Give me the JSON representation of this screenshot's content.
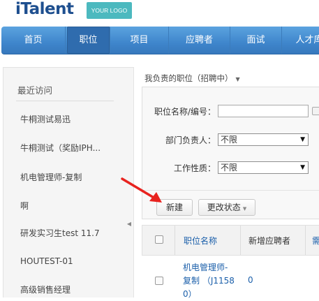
{
  "brand": {
    "name": "iTalent",
    "logo_placeholder": "YOUR LOGO"
  },
  "nav": {
    "items": [
      {
        "label": "首页"
      },
      {
        "label": "职位"
      },
      {
        "label": "项目"
      },
      {
        "label": "应聘者"
      },
      {
        "label": "面试"
      },
      {
        "label": "人才库"
      }
    ],
    "active_index": 1
  },
  "sidebar": {
    "title": "最近访问",
    "items": [
      {
        "label": "牛桐测试易迅"
      },
      {
        "label": "牛桐测试（奖励IPH..."
      },
      {
        "label": "机电管理师-复制"
      },
      {
        "label": "啊"
      },
      {
        "label": "研发实习生test 11.7"
      },
      {
        "label": "HOUTEST-01"
      },
      {
        "label": "高级销售经理"
      }
    ]
  },
  "main": {
    "section_title": "我负责的职位（招聘中）",
    "filters": {
      "name_label": "职位名称/编号：",
      "name_value": "",
      "owner_label": "部门负责人：",
      "owner_value": "不限",
      "nature_label": "工作性质：",
      "nature_value": "不限"
    },
    "buttons": {
      "new_label": "新建",
      "status_label": "更改状态"
    },
    "table": {
      "headers": [
        "职位名称",
        "新增应聘者",
        "需"
      ],
      "rows": [
        {
          "title_line1": "机电管理师-",
          "title_line2": "复制 （J1158",
          "title_line3": "0）",
          "new_applicants": "0"
        }
      ]
    }
  }
}
